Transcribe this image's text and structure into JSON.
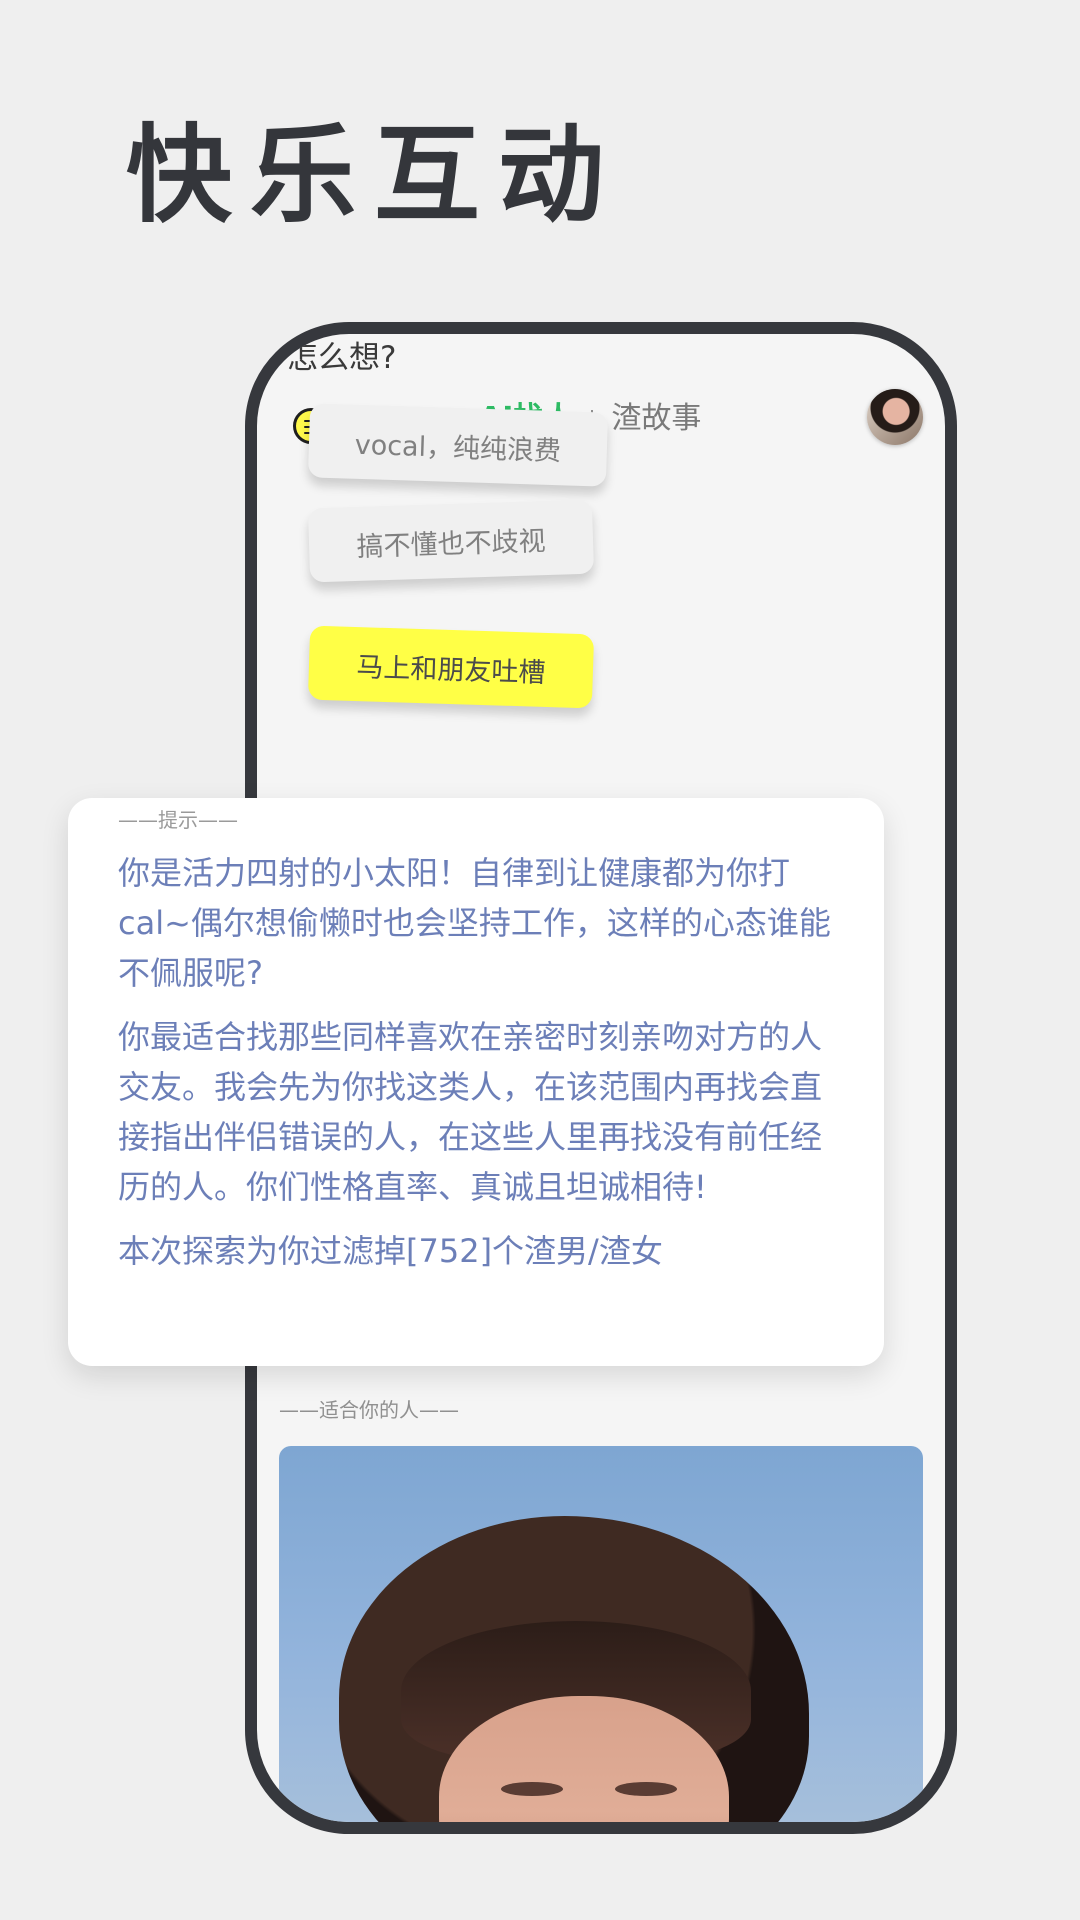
{
  "header": {
    "title": "快乐互动"
  },
  "phone": {
    "question_snippet": "怎么想?",
    "tabs": [
      {
        "label": "AI找人"
      },
      {
        "label": "渣故事"
      }
    ],
    "choices": [
      {
        "label": "vocal，纯纯浪费"
      },
      {
        "label": "搞不懂也不歧视"
      },
      {
        "label": "马上和朋友吐槽"
      }
    ],
    "match_section_label": "——适合你的人——"
  },
  "tip_card": {
    "label": "——提示——",
    "paragraphs": [
      "你是活力四射的小太阳！自律到让健康都为你打cal~偶尔想偷懒时也会坚持工作，这样的心态谁能不佩服呢?",
      "你最适合找那些同样喜欢在亲密时刻亲吻对方的人交友。我会先为你找这类人，在该范围内再找会直接指出伴侣错误的人，在这些人里再找没有前任经历的人。你们性格直率、真诚且坦诚相待!",
      "本次探索为你过滤掉[752]个渣男/渣女"
    ]
  },
  "icons": {
    "menu": "menu-icon",
    "avatar": "avatar"
  },
  "colors": {
    "background": "#efefef",
    "phone_frame": "#36383d",
    "accent_green": "#2ebb64",
    "accent_yellow": "#ffff46",
    "tip_text": "#6c7fb8"
  }
}
